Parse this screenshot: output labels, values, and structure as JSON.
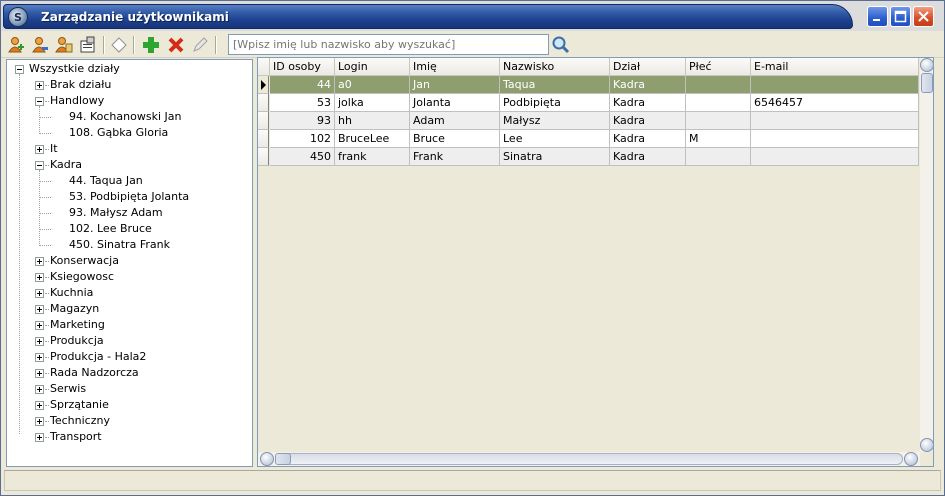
{
  "window": {
    "title": "Zarządzanie użytkownikami",
    "app_icon_glyph": "S"
  },
  "toolbar": {
    "buttons": [
      {
        "name": "add-user-icon"
      },
      {
        "name": "edit-user-icon"
      },
      {
        "name": "user-group-icon"
      },
      {
        "name": "user-properties-icon"
      },
      {
        "name": "clear-eraser-icon"
      },
      {
        "name": "add-plus-icon"
      },
      {
        "name": "delete-x-icon"
      },
      {
        "name": "edit-pencil-icon"
      }
    ],
    "search_placeholder": "[Wpisz imię lub nazwisko aby wyszukać]",
    "search_icon": "magnifier-icon"
  },
  "tree": {
    "root": "Wszystkie działy",
    "nodes": [
      {
        "label": "Brak działu",
        "expanded": false,
        "children": []
      },
      {
        "label": "Handlowy",
        "expanded": true,
        "children": [
          "94. Kochanowski Jan",
          "108. Gąbka Gloria"
        ]
      },
      {
        "label": "It",
        "expanded": false,
        "children": []
      },
      {
        "label": "Kadra",
        "expanded": true,
        "children": [
          "44. Taqua Jan",
          "53. Podbipięta Jolanta",
          "93. Małysz Adam",
          "102. Lee Bruce",
          "450. Sinatra Frank"
        ]
      },
      {
        "label": "Konserwacja",
        "expanded": false,
        "children": []
      },
      {
        "label": "Ksiegowosc",
        "expanded": false,
        "children": []
      },
      {
        "label": "Kuchnia",
        "expanded": false,
        "children": []
      },
      {
        "label": "Magazyn",
        "expanded": false,
        "children": []
      },
      {
        "label": "Marketing",
        "expanded": false,
        "children": []
      },
      {
        "label": "Produkcja",
        "expanded": false,
        "children": []
      },
      {
        "label": "Produkcja - Hala2",
        "expanded": false,
        "children": []
      },
      {
        "label": "Rada Nadzorcza",
        "expanded": false,
        "children": []
      },
      {
        "label": "Serwis",
        "expanded": false,
        "children": []
      },
      {
        "label": "Sprzątanie",
        "expanded": false,
        "children": []
      },
      {
        "label": "Techniczny",
        "expanded": false,
        "children": []
      },
      {
        "label": "Transport",
        "expanded": false,
        "children": []
      }
    ]
  },
  "grid": {
    "columns": [
      "ID osoby",
      "Login",
      "Imię",
      "Nazwisko",
      "Dział",
      "Płeć",
      "E-mail"
    ],
    "rows": [
      {
        "id": "44",
        "login": "a0",
        "imie": "Jan",
        "nazwisko": "Taqua",
        "dzial": "Kadra",
        "plec": "",
        "email": "",
        "selected": true
      },
      {
        "id": "53",
        "login": "jolka",
        "imie": "Jolanta",
        "nazwisko": "Podbipięta",
        "dzial": "Kadra",
        "plec": "",
        "email": "6546457",
        "selected": false
      },
      {
        "id": "93",
        "login": "hh",
        "imie": "Adam",
        "nazwisko": "Małysz",
        "dzial": "Kadra",
        "plec": "",
        "email": "",
        "selected": false
      },
      {
        "id": "102",
        "login": "BruceLee",
        "imie": "Bruce",
        "nazwisko": "Lee",
        "dzial": "Kadra",
        "plec": "M",
        "email": "",
        "selected": false
      },
      {
        "id": "450",
        "login": "frank",
        "imie": "Frank",
        "nazwisko": "Sinatra",
        "dzial": "Kadra",
        "plec": "",
        "email": "",
        "selected": false
      }
    ],
    "selection_color": "#8f9e6f"
  },
  "colors": {
    "titlebar": "#1d4190",
    "accent": "#2f5aa6"
  }
}
